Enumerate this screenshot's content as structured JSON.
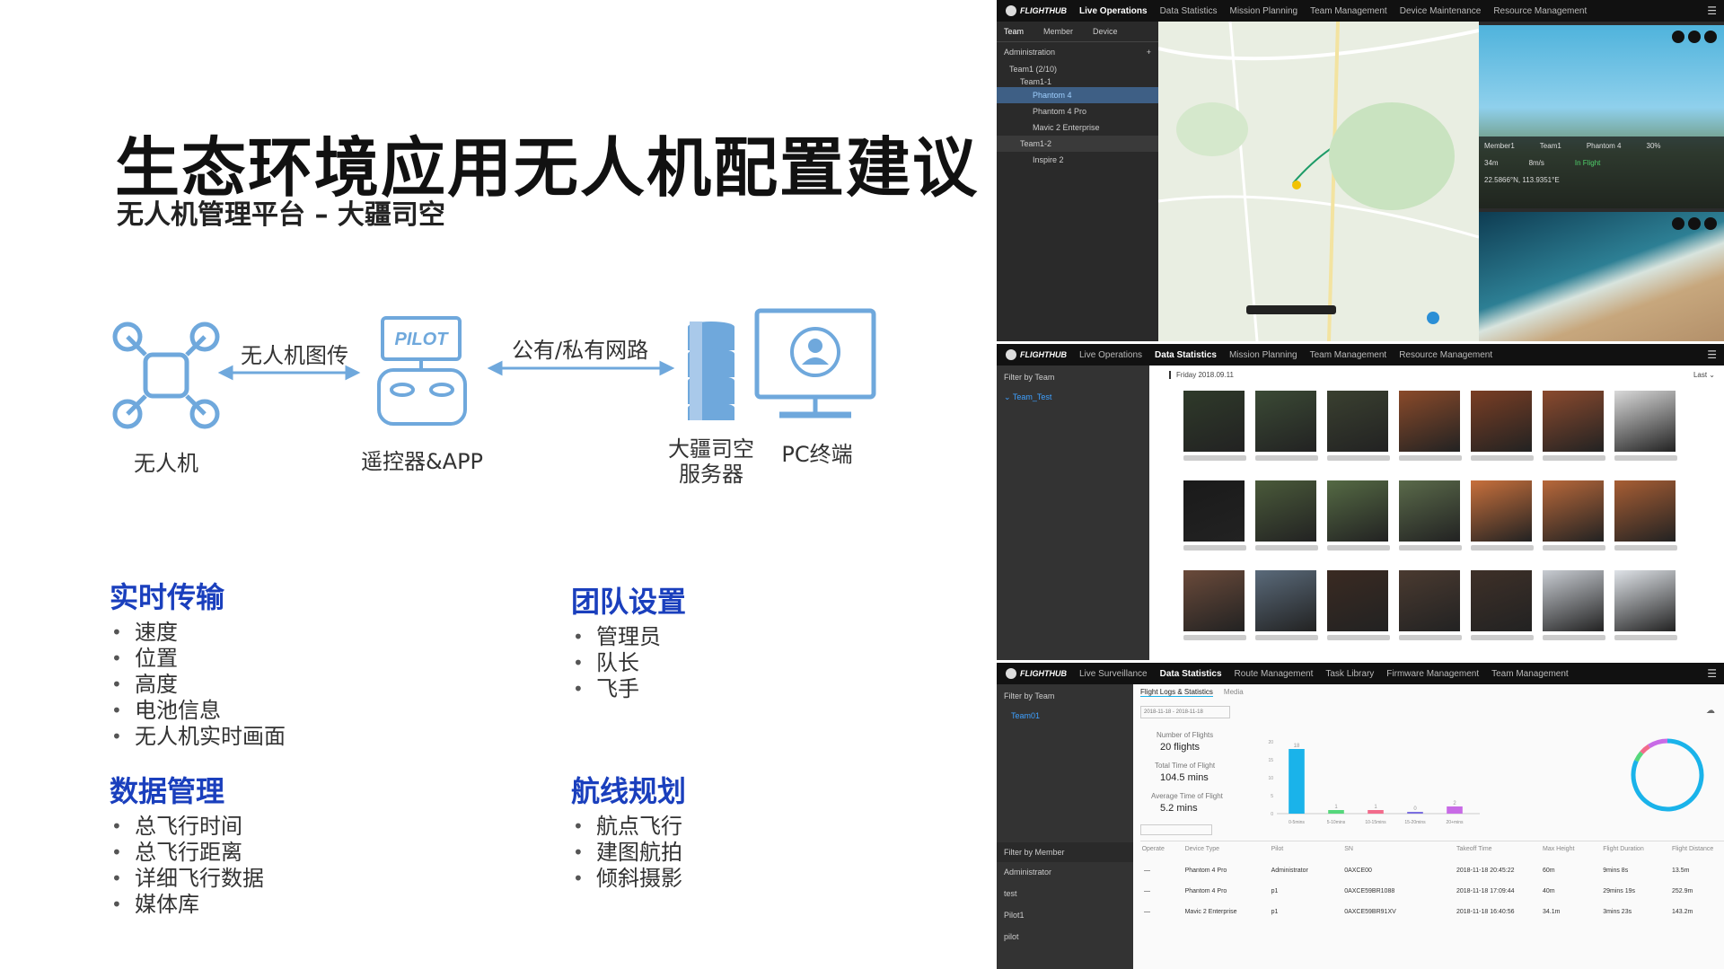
{
  "slide": {
    "title": "生态环境应用无人机配置建议",
    "subtitle": "无人机管理平台 – 大疆司空"
  },
  "architecture": {
    "drone_label": "无人机",
    "link1_label": "无人机图传",
    "remote_label": "遥控器&APP",
    "remote_badge": "PILOT",
    "link2_label": "公有/私有网路",
    "server_label_line1": "大疆司空",
    "server_label_line2": "服务器",
    "pc_label": "PC终端",
    "accent_color": "#6fa8dc"
  },
  "sections": {
    "realtime": {
      "title": "实时传输",
      "items": [
        "速度",
        "位置",
        "高度",
        "电池信息",
        "无人机实时画面"
      ]
    },
    "team": {
      "title": "团队设置",
      "items": [
        "管理员",
        "队长",
        "飞手"
      ]
    },
    "data": {
      "title": "数据管理",
      "items": [
        "总飞行时间",
        "总飞行距离",
        "详细飞行数据",
        "媒体库"
      ]
    },
    "route": {
      "title": "航线规划",
      "items": [
        "航点飞行",
        "建图航拍",
        "倾斜摄影"
      ]
    }
  },
  "shot1": {
    "logo": "FLIGHTHUB",
    "nav": [
      "Live Operations",
      "Data Statistics",
      "Mission Planning",
      "Team Management",
      "Device Maintenance",
      "Resource Management"
    ],
    "side_tabs": [
      "Team",
      "Member",
      "Device"
    ],
    "side_header": "Administration",
    "tree": [
      "Team1 (2/10)",
      "Team1-1",
      "Phantom 4",
      "Phantom 4 Pro",
      "Mavic 2 Enterprise",
      "Team1-2",
      "Inspire 2"
    ],
    "info_labels": [
      "Member1",
      "Team1",
      "Phantom 4",
      "30%"
    ],
    "info_values": [
      "34m",
      "8m/s",
      "In Flight"
    ],
    "coords": "22.5866°N, 113.9351°E"
  },
  "shot2": {
    "logo": "FLIGHTHUB",
    "nav": [
      "Live Operations",
      "Data Statistics",
      "Mission Planning",
      "Team Management",
      "Resource Management"
    ],
    "filter_label": "Filter by Team",
    "team_item": "Team_Test",
    "date_header": "Friday 2018.09.11",
    "sort_label": "Last"
  },
  "shot3": {
    "logo": "FLIGHTHUB",
    "nav": [
      "Live Surveillance",
      "Data Statistics",
      "Route Management",
      "Task Library",
      "Firmware Management",
      "Team Management"
    ],
    "filter_team": "Filter by Team",
    "team_item": "Team01",
    "tabs": [
      "Flight Logs & Statistics",
      "Media"
    ],
    "date_range": "2018-11-18 - 2018-11-18",
    "stats": {
      "flights_label": "Number of Flights",
      "flights_value": "20 flights",
      "time_label": "Total Time of Flight",
      "time_value": "104.5 mins",
      "avg_label": "Average Time of Flight",
      "avg_value": "5.2 mins"
    },
    "filter_member": "Filter by Member",
    "members": [
      "Administrator",
      "test",
      "Pilot1",
      "pilot"
    ],
    "table_headers": [
      "Operate",
      "Device Type",
      "Pilot",
      "SN",
      "Takeoff Time",
      "Max Height",
      "Flight Duration",
      "Flight Distance"
    ],
    "rows": [
      [
        "Phantom 4 Pro",
        "Administrator",
        "0AXCE00",
        "2018-11-18 20:45:22",
        "60m",
        "9mins 8s",
        "13.5m"
      ],
      [
        "Phantom 4 Pro",
        "p1",
        "0AXCE59BR1088",
        "2018-11-18 17:09:44",
        "40m",
        "29mins 19s",
        "252.9m"
      ],
      [
        "Mavic 2 Enterprise",
        "p1",
        "0AXCE59BR91XV",
        "2018-11-18 16:40:56",
        "34.1m",
        "3mins 23s",
        "143.2m"
      ]
    ],
    "legend": [
      "0-5mins",
      "5-10mins",
      "10-15mins",
      "15-20mins",
      "20+mins"
    ]
  },
  "chart_data": {
    "type": "bar",
    "categories": [
      "0-5mins",
      "5-10mins",
      "10-15mins",
      "15-20mins",
      "20+mins"
    ],
    "values": [
      18,
      1,
      1,
      0,
      2
    ],
    "ylim": [
      0,
      20
    ],
    "colors": [
      "#1ab3ea",
      "#55d77b",
      "#f26b8b",
      "#7b6fe0",
      "#c86be6"
    ]
  }
}
